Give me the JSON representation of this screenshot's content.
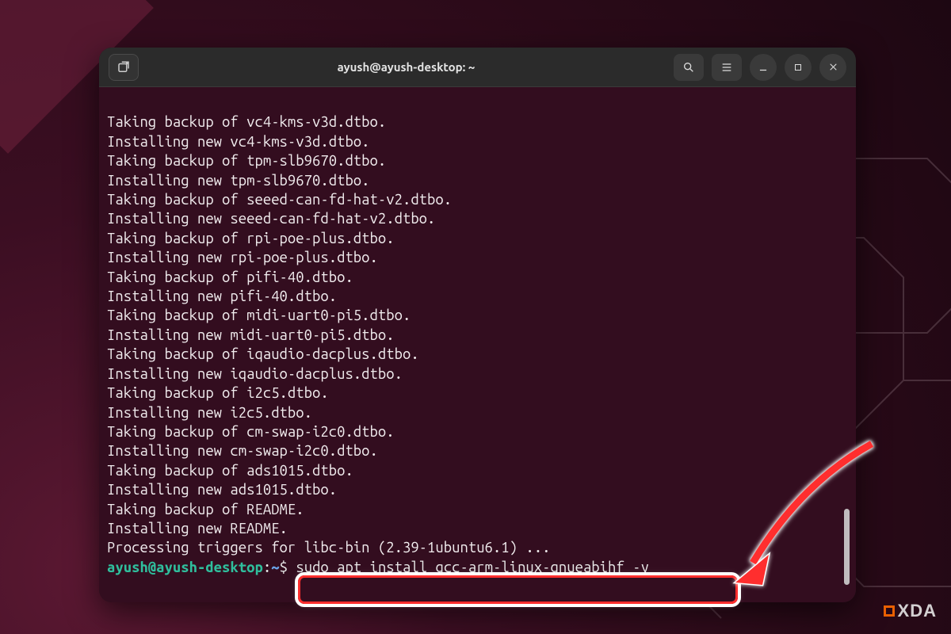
{
  "window": {
    "title": "ayush@ayush-desktop: ~"
  },
  "prompt": {
    "user_host": "ayush@ayush-desktop",
    "path": "~",
    "symbol": "$",
    "command": "sudo apt install gcc-arm-linux-gnueabihf -y"
  },
  "output_lines": [
    "Taking backup of vc4-kms-v3d.dtbo.",
    "Installing new vc4-kms-v3d.dtbo.",
    "Taking backup of tpm-slb9670.dtbo.",
    "Installing new tpm-slb9670.dtbo.",
    "Taking backup of seeed-can-fd-hat-v2.dtbo.",
    "Installing new seeed-can-fd-hat-v2.dtbo.",
    "Taking backup of rpi-poe-plus.dtbo.",
    "Installing new rpi-poe-plus.dtbo.",
    "Taking backup of pifi-40.dtbo.",
    "Installing new pifi-40.dtbo.",
    "Taking backup of midi-uart0-pi5.dtbo.",
    "Installing new midi-uart0-pi5.dtbo.",
    "Taking backup of iqaudio-dacplus.dtbo.",
    "Installing new iqaudio-dacplus.dtbo.",
    "Taking backup of i2c5.dtbo.",
    "Installing new i2c5.dtbo.",
    "Taking backup of cm-swap-i2c0.dtbo.",
    "Installing new cm-swap-i2c0.dtbo.",
    "Taking backup of ads1015.dtbo.",
    "Installing new ads1015.dtbo.",
    "Taking backup of README.",
    "Installing new README.",
    "Processing triggers for libc-bin (2.39-1ubuntu6.1) ..."
  ],
  "icons": {
    "new_tab": "new-tab-icon",
    "search": "search-icon",
    "menu": "hamburger-icon",
    "minimize": "minimize-icon",
    "maximize": "maximize-icon",
    "close": "close-icon"
  },
  "watermark": {
    "text": "XDA"
  }
}
